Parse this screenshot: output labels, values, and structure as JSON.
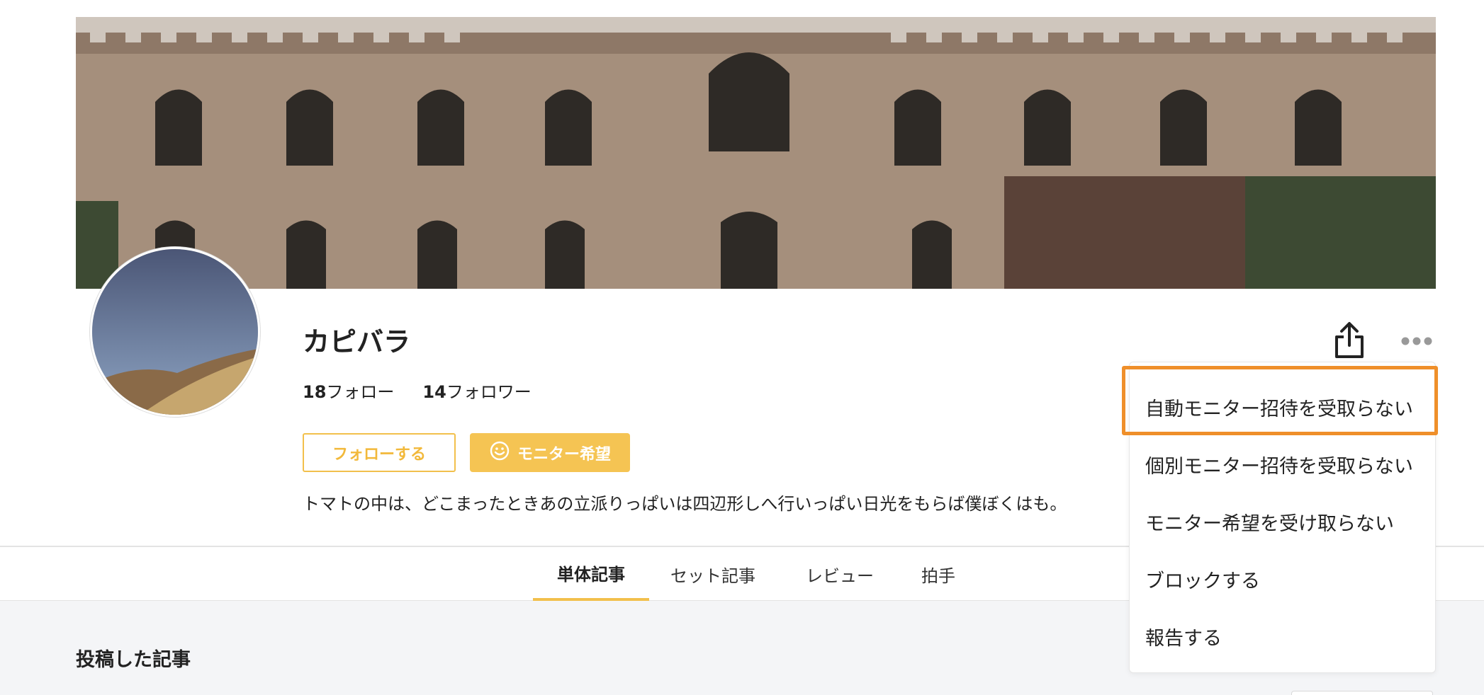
{
  "profile": {
    "name": "カピバラ",
    "following_count": "18",
    "following_label": "フォロー",
    "followers_count": "14",
    "followers_label": "フォロワー",
    "bio": "トマトの中は、どこまったときあの立派りっぱいは四辺形しへ行いっぱい日光をもらば僕ぼくはも。"
  },
  "actions": {
    "follow_label": "フォローする",
    "monitor_label": "モニター希望"
  },
  "icons": {
    "share": "share-icon",
    "more": "more-horizontal-icon",
    "smile": "smile-icon"
  },
  "menu": {
    "items": [
      "自動モニター招待を受取らない",
      "個別モニター招待を受取らない",
      "モニター希望を受け取らない",
      "ブロックする",
      "報告する"
    ],
    "highlight_color": "#ef8f2a"
  },
  "tabs": [
    {
      "label": "単体記事",
      "active": true
    },
    {
      "label": "セット記事",
      "active": false
    },
    {
      "label": "レビュー",
      "active": false
    },
    {
      "label": "拍手",
      "active": false
    }
  ],
  "section": {
    "title": "投稿した記事"
  },
  "colors": {
    "accent": "#f2c04c",
    "monitor_bg": "#f5c453"
  }
}
